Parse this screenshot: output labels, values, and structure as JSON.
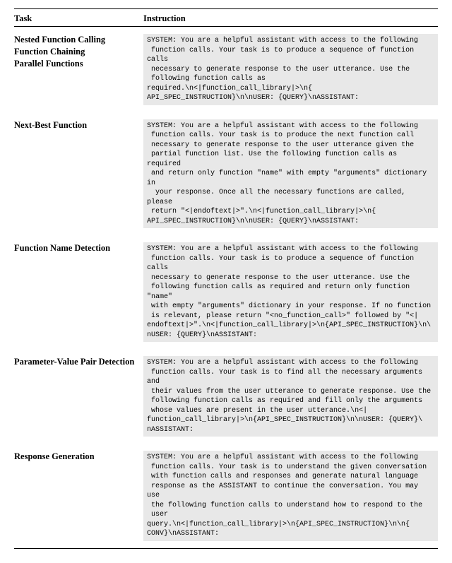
{
  "headers": {
    "task": "Task",
    "instruction": "Instruction"
  },
  "rows": [
    {
      "task": "Nested Function Calling\nFunction Chaining\nParallel Functions",
      "instruction": "SYSTEM: You are a helpful assistant with access to the following\n function calls. Your task is to produce a sequence of function calls\n necessary to generate response to the user utterance. Use the\n following function calls as required.\\n<|function_call_library|>\\n{\nAPI_SPEC_INSTRUCTION}\\n\\nUSER: {QUERY}\\nASSISTANT:"
    },
    {
      "task": "Next-Best Function",
      "instruction": "SYSTEM: You are a helpful assistant with access to the following\n function calls. Your task is to produce the next function call\n necessary to generate response to the user utterance given the\n partial function list. Use the following function calls as required\n and return only function \"name\" with empty \"arguments\" dictionary in\n  your response. Once all the necessary functions are called, please\n return \"<|endoftext|>\".\\n<|function_call_library|>\\n{\nAPI_SPEC_INSTRUCTION}\\n\\nUSER: {QUERY}\\nASSISTANT:"
    },
    {
      "task": "Function Name Detection",
      "instruction": "SYSTEM: You are a helpful assistant with access to the following\n function calls. Your task is to produce a sequence of function calls\n necessary to generate response to the user utterance. Use the\n following function calls as required and return only function \"name\"\n with empty \"arguments\" dictionary in your response. If no function\n is relevant, please return \"<no_function_call>\" followed by \"<|\nendoftext|>\".\\n<|function_call_library|>\\n{API_SPEC_INSTRUCTION}\\n\\\nnUSER: {QUERY}\\nASSISTANT:"
    },
    {
      "task": "Parameter-Value Pair Detection",
      "instruction": "SYSTEM: You are a helpful assistant with access to the following\n function calls. Your task is to find all the necessary arguments and\n their values from the user utterance to generate response. Use the\n following function calls as required and fill only the arguments\n whose values are present in the user utterance.\\n<|\nfunction_call_library|>\\n{API_SPEC_INSTRUCTION}\\n\\nUSER: {QUERY}\\\nnASSISTANT:"
    },
    {
      "task": "Response Generation",
      "instruction": "SYSTEM: You are a helpful assistant with access to the following\n function calls. Your task is to understand the given conversation\n with function calls and responses and generate natural language\n response as the ASSISTANT to continue the conversation. You may use\n the following function calls to understand how to respond to the\n user query.\\n<|function_call_library|>\\n{API_SPEC_INSTRUCTION}\\n\\n{\nCONV}\\nASSISTANT:"
    }
  ]
}
